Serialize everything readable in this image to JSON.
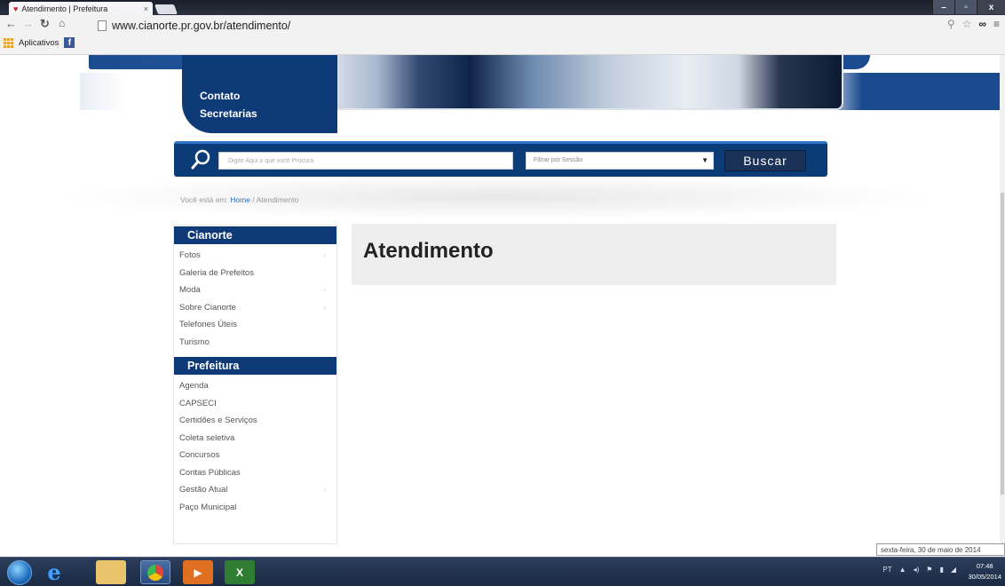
{
  "browser": {
    "tab_title": "Atendimento | Prefeitura",
    "tab_close": "×",
    "url": "www.cianorte.pr.gov.br/atendimento/",
    "bookmarks_apps": "Aplicativos",
    "window_buttons": {
      "minimize": "–",
      "maximize": "▫",
      "close": "x"
    }
  },
  "site": {
    "menu": [
      "Contato",
      "Secretarias"
    ],
    "search": {
      "placeholder": "Digite Aqui o que você Procura",
      "filter_placeholder": "Filtrar por Sessão",
      "button": "Buscar"
    },
    "breadcrumb": {
      "prefix": "Você está em:",
      "home": "Home",
      "separator": "/",
      "current": "Atendimento"
    },
    "sidebar": {
      "cianorte": {
        "title": "Cianorte",
        "items": [
          {
            "label": "Fotos",
            "chev": "›"
          },
          {
            "label": "Galeria de Prefeitos",
            "chev": ""
          },
          {
            "label": "Moda",
            "chev": "›"
          },
          {
            "label": "Sobre Cianorte",
            "chev": "›"
          },
          {
            "label": "Telefones Úteis",
            "chev": ""
          },
          {
            "label": "Turismo",
            "chev": ""
          }
        ]
      },
      "prefeitura": {
        "title": "Prefeitura",
        "items": [
          {
            "label": "Agenda",
            "chev": ""
          },
          {
            "label": "CAPSECI",
            "chev": ""
          },
          {
            "label": "Certidões e Serviços",
            "chev": ""
          },
          {
            "label": "Coleta seletiva",
            "chev": ""
          },
          {
            "label": "Concursos",
            "chev": ""
          },
          {
            "label": "Contas Públicas",
            "chev": ""
          },
          {
            "label": "Gestão Atual",
            "chev": "›"
          },
          {
            "label": "Paço Municipal",
            "chev": ""
          }
        ]
      }
    },
    "page_title": "Atendimento"
  },
  "taskbar": {
    "lang": "PT",
    "time": "07:48",
    "date": "30/05/2014",
    "date_tooltip": "sexta-feira, 30 de maio de 2014"
  },
  "colors": {
    "brand_blue": "#0e3a77",
    "search_bar": "#0c3c78",
    "buscar_button": "#1a3158"
  }
}
